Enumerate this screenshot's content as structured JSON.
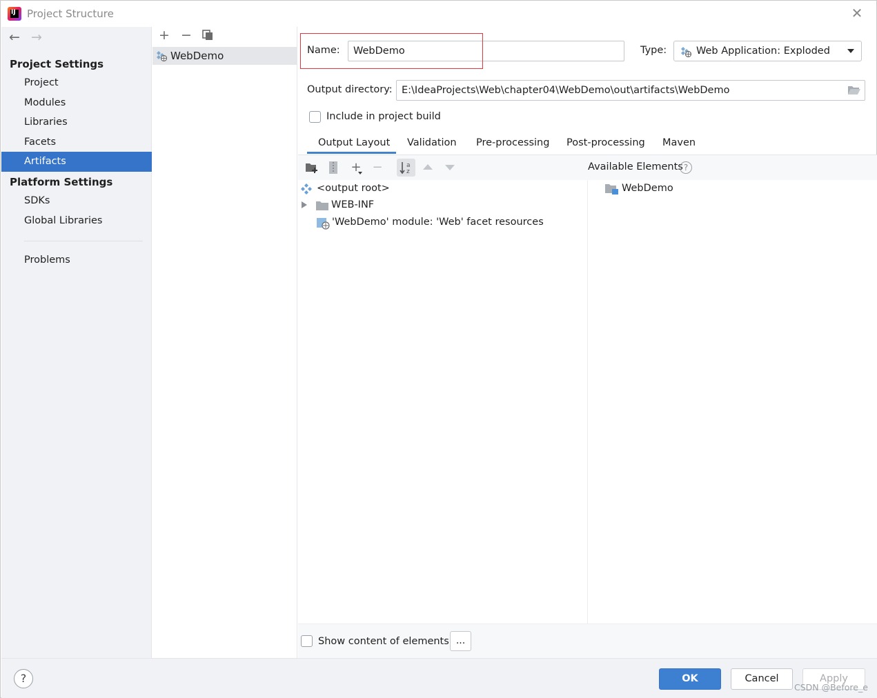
{
  "window": {
    "title": "Project Structure"
  },
  "sidebar": {
    "project_settings_heading": "Project Settings",
    "project_items": [
      {
        "label": "Project"
      },
      {
        "label": "Modules"
      },
      {
        "label": "Libraries"
      },
      {
        "label": "Facets"
      },
      {
        "label": "Artifacts",
        "selected": true
      }
    ],
    "platform_settings_heading": "Platform Settings",
    "platform_items": [
      {
        "label": "SDKs"
      },
      {
        "label": "Global Libraries"
      }
    ],
    "problems_label": "Problems"
  },
  "artifacts_list": {
    "items": [
      {
        "label": "WebDemo",
        "selected": true
      }
    ]
  },
  "artifact": {
    "name_label": "Name:",
    "name_value": "WebDemo",
    "type_label": "Type:",
    "type_value": "Web Application: Exploded",
    "output_dir_label": "Output directory:",
    "output_dir_value": "E:\\IdeaProjects\\Web\\chapter04\\WebDemo\\out\\artifacts\\WebDemo",
    "include_in_build_label": "Include in project build",
    "include_in_build_checked": false
  },
  "tabs": [
    {
      "label": "Output Layout",
      "active": true
    },
    {
      "label": "Validation"
    },
    {
      "label": "Pre-processing"
    },
    {
      "label": "Post-processing"
    },
    {
      "label": "Maven"
    }
  ],
  "layout_tree": {
    "items": [
      {
        "label": "<output root>",
        "icon": "output-root-icon"
      },
      {
        "label": "WEB-INF",
        "icon": "folder-icon",
        "expandable": true
      },
      {
        "label": "'WebDemo' module: 'Web' facet resources",
        "icon": "web-facet-icon"
      }
    ]
  },
  "available_elements": {
    "label": "Available Elements",
    "items": [
      {
        "label": "WebDemo",
        "icon": "module-folder-icon"
      }
    ]
  },
  "show_content": {
    "label": "Show content of elements",
    "checked": false,
    "button_label": "..."
  },
  "footer": {
    "help_label": "?",
    "ok_label": "OK",
    "cancel_label": "Cancel",
    "apply_label": "Apply",
    "watermark": "CSDN @Before_e"
  },
  "colors": {
    "accent": "#3574c9",
    "highlight_box": "#e0383e",
    "ok_button": "#3d7fd1"
  }
}
